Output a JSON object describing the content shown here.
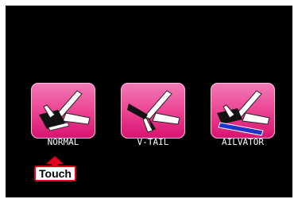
{
  "modes": [
    {
      "label": "NORMAL",
      "icon": "normal-tail-plane-icon"
    },
    {
      "label": "V-TAIL",
      "icon": "v-tail-plane-icon"
    },
    {
      "label": "AILVATOR",
      "icon": "ailvator-plane-icon"
    }
  ],
  "hint": {
    "label": "Touch",
    "icon": "up-arrow-icon"
  },
  "colors": {
    "screen_bg": "#000000",
    "button_pink": "#ee4a97",
    "hint_red": "#e2001a",
    "ailvator_blue": "#2233cc"
  }
}
